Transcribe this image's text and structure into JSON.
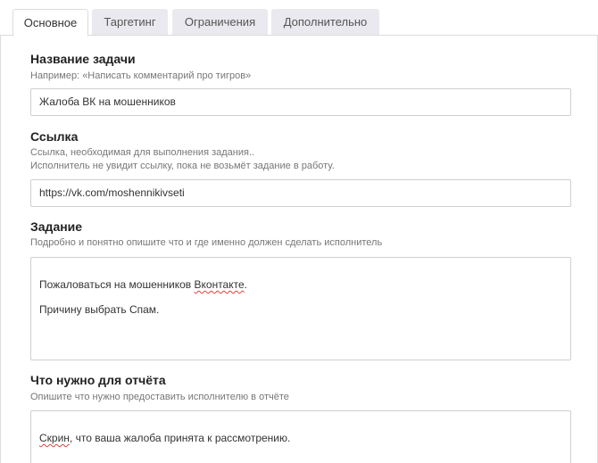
{
  "tabs": [
    {
      "label": "Основное"
    },
    {
      "label": "Таргетинг"
    },
    {
      "label": "Ограничения"
    },
    {
      "label": "Дополнительно"
    }
  ],
  "form": {
    "task_name": {
      "label": "Название задачи",
      "hint": "Например: «Написать комментарий про тигров»",
      "value": "Жалоба ВК на мошенников"
    },
    "link": {
      "label": "Ссылка",
      "hint_line1": "Ссылка, необходимая для выполнения задания..",
      "hint_line2": "Исполнитель не увидит ссылку, пока не возьмёт задание в работу.",
      "value": "https://vk.com/moshennikivseti"
    },
    "task": {
      "label": "Задание",
      "hint": "Подробно и понятно опишите что и где именно должен сделать исполнитель",
      "line1_before": "Пожаловаться на мошенников ",
      "line1_misspelled": "Вконтакте",
      "line1_after": ".",
      "line2": "Причину выбрать Спам."
    },
    "report": {
      "label": "Что нужно для отчёта",
      "hint": "Опишите что нужно предоставить исполнителю в отчёте",
      "value_misspelled": "Скрин",
      "value_rest": ", что ваша жалоба принята к рассмотрению."
    }
  }
}
